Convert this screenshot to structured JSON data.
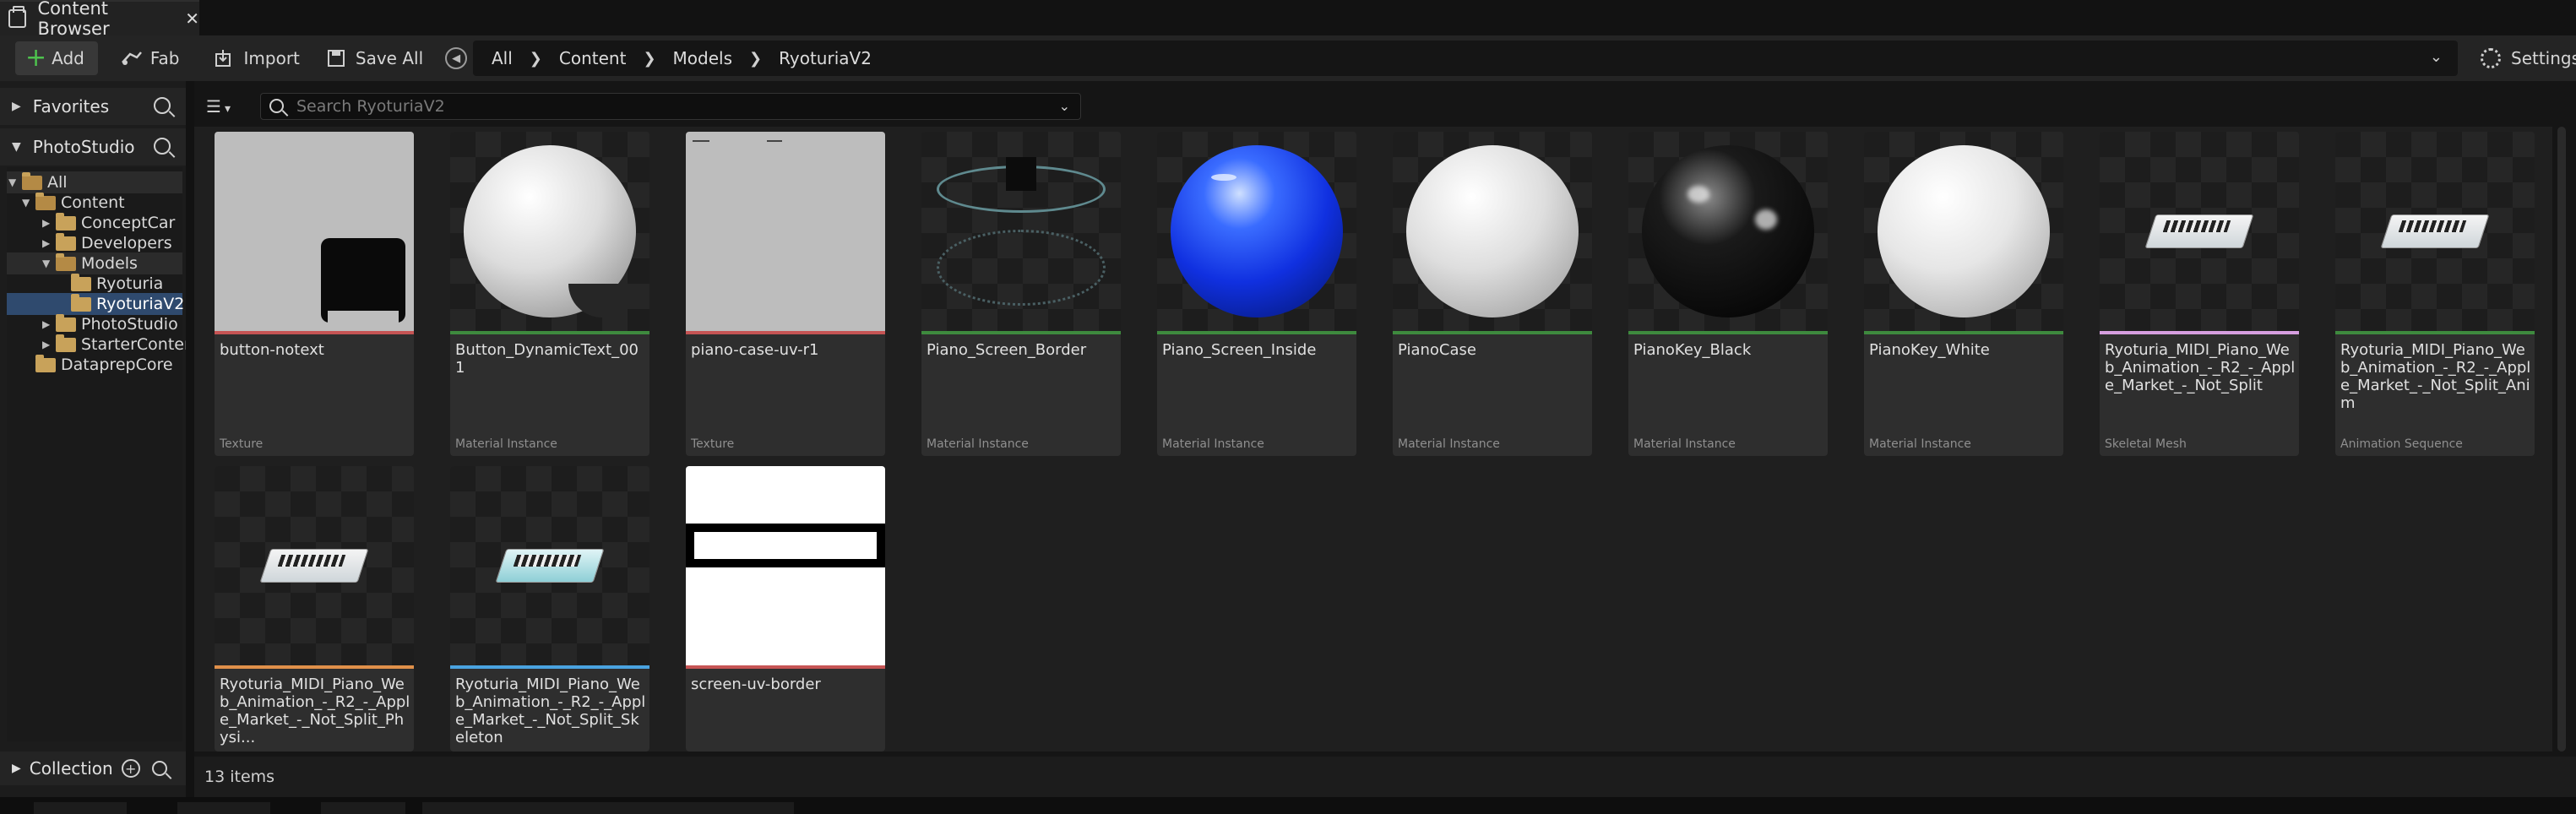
{
  "window": {
    "tab_title": "Content Browser",
    "tab_close": "✕"
  },
  "toolbar": {
    "add_label": "Add",
    "fab_label": "Fab",
    "import_label": "Import",
    "save_all_label": "Save All",
    "settings_label": "Settings"
  },
  "breadcrumb": [
    "All",
    "Content",
    "Models",
    "RyoturiaV2"
  ],
  "left_panel": {
    "favorites_label": "Favorites",
    "source_label": "PhotoStudio",
    "collections_label": "Collection",
    "tree": [
      {
        "label": "All",
        "depth": 0,
        "expanded": true
      },
      {
        "label": "Content",
        "depth": 1,
        "expanded": true
      },
      {
        "label": "ConceptCar",
        "depth": 2,
        "expanded": false
      },
      {
        "label": "Developers",
        "depth": 2,
        "expanded": false
      },
      {
        "label": "Models",
        "depth": 2,
        "expanded": true
      },
      {
        "label": "Ryoturia",
        "depth": 3,
        "expanded": false
      },
      {
        "label": "RyoturiaV2",
        "depth": 3,
        "expanded": false,
        "selected": true
      },
      {
        "label": "PhotoStudio",
        "depth": 2,
        "expanded": false
      },
      {
        "label": "StarterContent",
        "depth": 2,
        "expanded": false
      },
      {
        "label": "DataprepCore",
        "depth": 1,
        "expanded": false
      }
    ]
  },
  "search": {
    "placeholder": "Search RyoturiaV2"
  },
  "assets": [
    {
      "name": "button-notext",
      "type": "Texture",
      "color": "#c65454"
    },
    {
      "name": "Button_DynamicText_001",
      "type": "Material Instance",
      "color": "#3e8a3e"
    },
    {
      "name": "piano-case-uv-r1",
      "type": "Texture",
      "color": "#c65454"
    },
    {
      "name": "Piano_Screen_Border",
      "type": "Material Instance",
      "color": "#3e8a3e"
    },
    {
      "name": "Piano_Screen_Inside",
      "type": "Material Instance",
      "color": "#3e8a3e"
    },
    {
      "name": "PianoCase",
      "type": "Material Instance",
      "color": "#3e8a3e"
    },
    {
      "name": "PianoKey_Black",
      "type": "Material Instance",
      "color": "#3e8a3e"
    },
    {
      "name": "PianoKey_White",
      "type": "Material Instance",
      "color": "#3e8a3e"
    },
    {
      "name": "Ryoturia_MIDI_Piano_Web_Animation_-_R2_-_Apple_Market_-_Not_Split",
      "type": "Skeletal Mesh",
      "color": "#d79fe0"
    },
    {
      "name": "Ryoturia_MIDI_Piano_Web_Animation_-_R2_-_Apple_Market_-_Not_Split_Anim",
      "type": "Animation Sequence",
      "color": "#3e8a3e"
    },
    {
      "name": "Ryoturia_MIDI_Piano_Web_Animation_-_R2_-_Apple_Market_-_Not_Split_Physi...",
      "type": "",
      "color": "#e0904a"
    },
    {
      "name": "Ryoturia_MIDI_Piano_Web_Animation_-_R2_-_Apple_Market_-_Not_Split_Skeleton",
      "type": "",
      "color": "#4aa3e0"
    },
    {
      "name": "screen-uv-border",
      "type": "",
      "color": "#c65454"
    }
  ],
  "status": {
    "item_count": "13 items"
  },
  "colors": {
    "accent": "#4ec34e",
    "selection": "#2f4a6e",
    "background": "#1f1f1f"
  }
}
